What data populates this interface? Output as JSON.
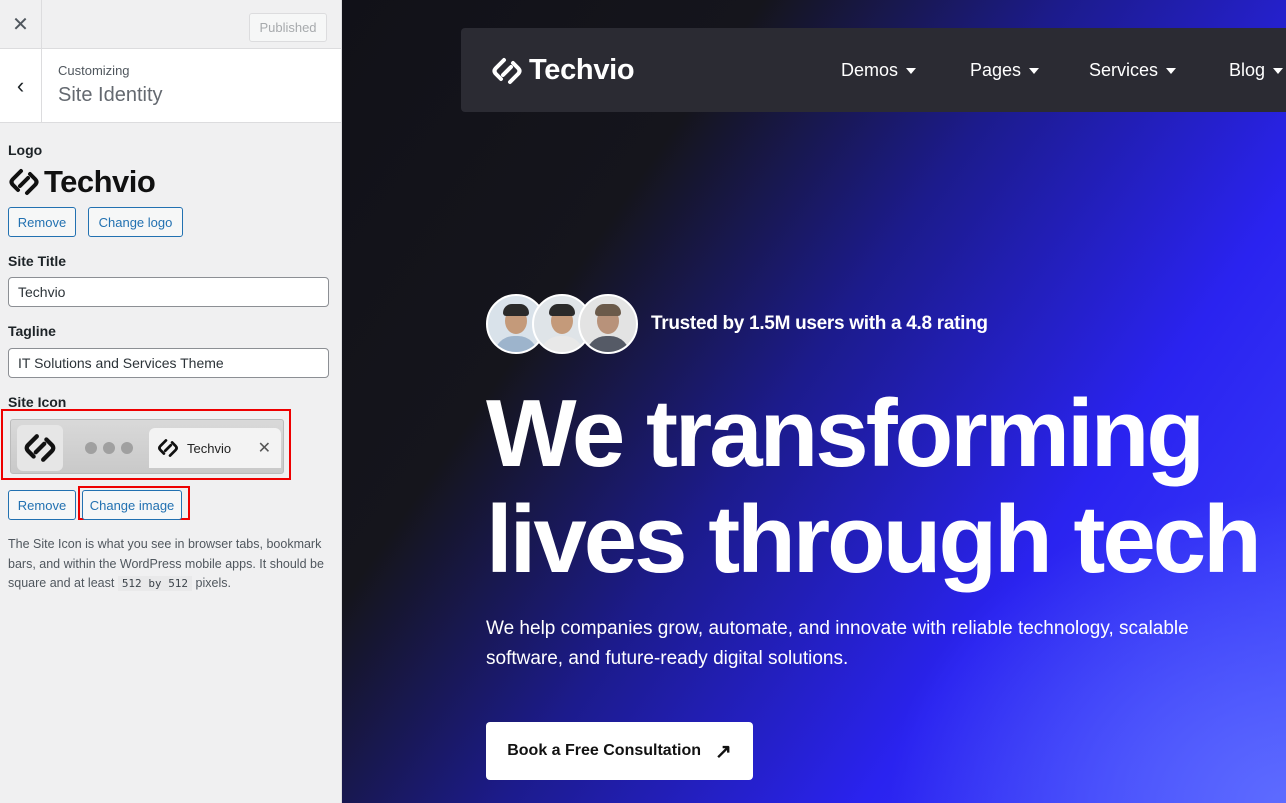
{
  "topbar": {
    "close_icon": "close-icon",
    "published_label": "Published"
  },
  "section": {
    "subtitle": "Customizing",
    "title": "Site Identity"
  },
  "logo": {
    "label": "Logo",
    "brand_text": "Techvio",
    "remove_label": "Remove",
    "change_label": "Change logo"
  },
  "site_title": {
    "label": "Site Title",
    "value": "Techvio"
  },
  "tagline": {
    "label": "Tagline",
    "value": "IT Solutions and Services Theme"
  },
  "site_icon": {
    "label": "Site Icon",
    "tab_label": "Techvio",
    "remove_label": "Remove",
    "change_label": "Change image",
    "desc_part1": "The Site Icon is what you see in browser tabs, bookmark bars, and within the WordPress mobile apps. It should be square and at least",
    "size1": "512",
    "by": "by",
    "size2": "512",
    "desc_part2": "pixels."
  },
  "preview": {
    "brand": "Techvio",
    "nav": [
      {
        "label": "Demos"
      },
      {
        "label": "Pages"
      },
      {
        "label": "Services"
      },
      {
        "label": "Blog"
      }
    ],
    "trusted_text": "Trusted by 1.5M users with a 4.8 rating",
    "hero_line1": "We transforming",
    "hero_line2": "lives through tech",
    "hero_sub": "We help companies grow, automate, and innovate with reliable technology, scalable software, and future-ready digital solutions.",
    "cta_label": "Book a Free Consultation"
  },
  "colors": {
    "wp_blue": "#2271b1",
    "highlight_red": "#ee0000",
    "hero_blue": "#2a23f0"
  }
}
